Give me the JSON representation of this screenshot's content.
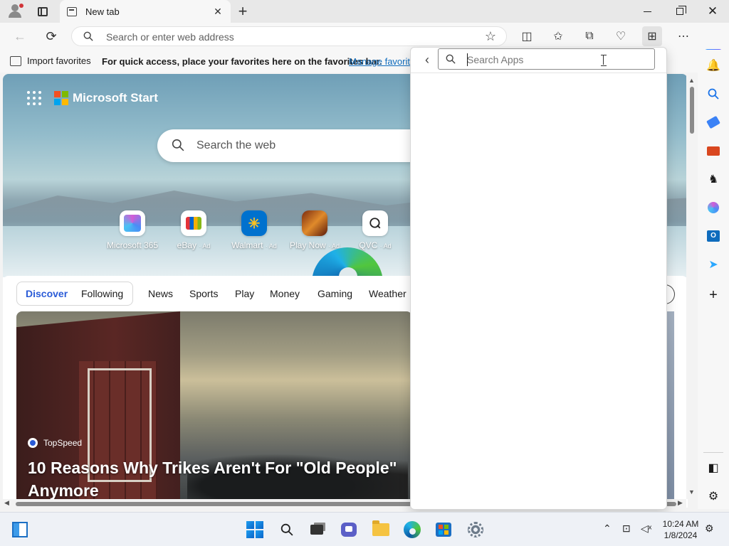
{
  "tab": {
    "title": "New tab"
  },
  "address_bar": {
    "placeholder": "Search or enter web address"
  },
  "favorites_bar": {
    "import_label": "Import favorites",
    "hint": "For quick access, place your favorites here on the favorites bar.",
    "manage_link": "Manage favorites"
  },
  "start_page": {
    "brand": "Microsoft Start",
    "search_placeholder": "Search the web",
    "quick_links": [
      {
        "label": "Microsoft 365",
        "ad": "",
        "icon": "microsoft-365-icon"
      },
      {
        "label": "eBay",
        "ad": "· Ad",
        "icon": "ebay-icon"
      },
      {
        "label": "Walmart",
        "ad": "· Ad",
        "icon": "walmart-icon"
      },
      {
        "label": "Play Now",
        "ad": "· Ad",
        "icon": "game-icon"
      },
      {
        "label": "QVC",
        "ad": "· Ad",
        "icon": "qvc-icon"
      }
    ],
    "feed_tabs": [
      "Discover",
      "Following",
      "News",
      "Sports",
      "Play",
      "Money",
      "Gaming",
      "Weather"
    ],
    "selected_tab": "Discover",
    "story": {
      "source": "TopSpeed",
      "headline": "10 Reasons Why Trikes Aren't For \"Old People\" Anymore"
    }
  },
  "apps_panel": {
    "search_placeholder": "Search Apps"
  },
  "taskbar": {
    "time": "10:24 AM",
    "date": "1/8/2024"
  },
  "colors": {
    "accent": "#2a5bd7",
    "link": "#0f6cbd",
    "taskbar": "#eef1f6"
  }
}
